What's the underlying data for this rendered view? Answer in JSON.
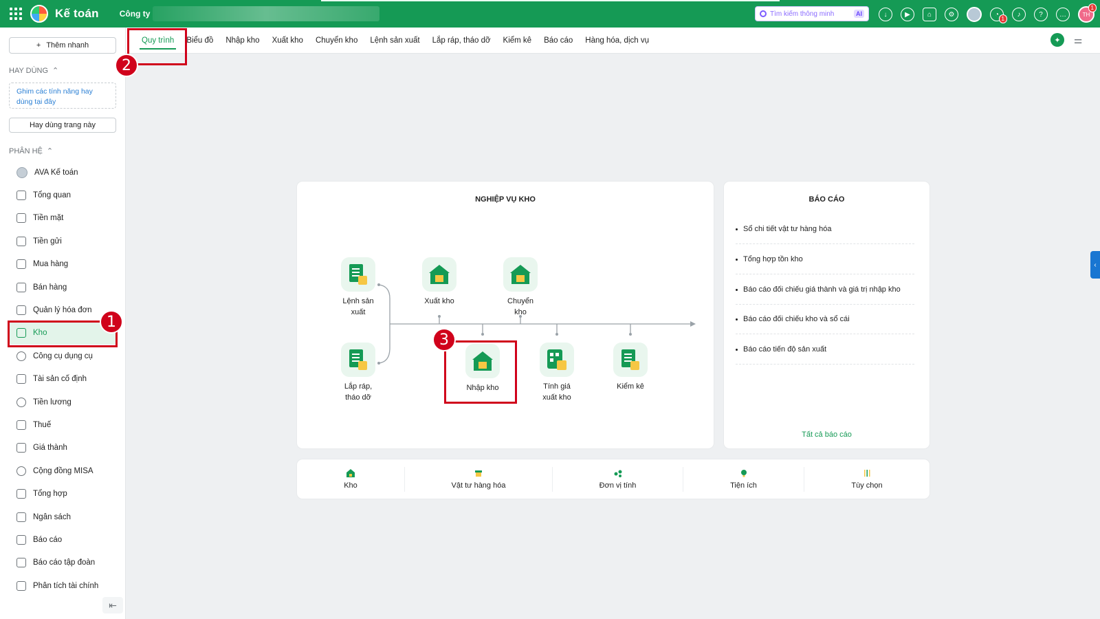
{
  "app": {
    "title": "Kế toán",
    "company_label": "Công ty"
  },
  "search": {
    "placeholder": "Tìm kiếm thông minh",
    "ai_badge": "AI"
  },
  "top_badges": {
    "chat_count": "1",
    "avatar_initials": "TH",
    "avatar_badge": "1"
  },
  "sidebar": {
    "add_button": "Thêm nhanh",
    "favorites_header": "HAY DÙNG",
    "pin_hint": "Ghim các tính năng hay dùng tại đây",
    "favorite_page_button": "Hay dùng trang này",
    "modules_header": "PHÂN HỆ",
    "items": [
      {
        "label": "AVA Kế toán",
        "icon": "ava-avatar-icon"
      },
      {
        "label": "Tổng quan",
        "icon": "dashboard-icon"
      },
      {
        "label": "Tiền mặt",
        "icon": "cash-icon"
      },
      {
        "label": "Tiền gửi",
        "icon": "bank-icon"
      },
      {
        "label": "Mua hàng",
        "icon": "shopping-bag-icon"
      },
      {
        "label": "Bán hàng",
        "icon": "cart-icon"
      },
      {
        "label": "Quản lý hóa đơn",
        "icon": "invoice-icon"
      },
      {
        "label": "Kho",
        "icon": "warehouse-icon"
      },
      {
        "label": "Công cụ dụng cụ",
        "icon": "tools-icon"
      },
      {
        "label": "Tài sản cố định",
        "icon": "truck-icon"
      },
      {
        "label": "Tiền lương",
        "icon": "salary-icon"
      },
      {
        "label": "Thuế",
        "icon": "tax-icon"
      },
      {
        "label": "Giá thành",
        "icon": "price-tag-icon"
      },
      {
        "label": "Cộng đồng MISA",
        "icon": "community-icon"
      },
      {
        "label": "Tổng hợp",
        "icon": "summary-icon"
      },
      {
        "label": "Ngân sách",
        "icon": "budget-icon"
      },
      {
        "label": "Báo cáo",
        "icon": "bar-chart-icon"
      },
      {
        "label": "Báo cáo tập đoàn",
        "icon": "group-report-icon"
      },
      {
        "label": "Phân tích tài chính",
        "icon": "analytics-icon"
      }
    ],
    "active_item": "Kho"
  },
  "tabs": [
    "Quy trình",
    "Biểu đồ",
    "Nhập kho",
    "Xuất kho",
    "Chuyển kho",
    "Lệnh sản xuất",
    "Lắp ráp, tháo dỡ",
    "Kiểm kê",
    "Báo cáo",
    "Hàng hóa, dịch vụ"
  ],
  "active_tab": "Quy trình",
  "workflow": {
    "title": "NGHIỆP VỤ KHO",
    "nodes": {
      "production_order": "Lệnh sản xuất",
      "stock_out": "Xuất kho",
      "transfer": "Chuyển kho",
      "assembly": "Lắp ráp, tháo dỡ",
      "stock_in": "Nhập kho",
      "cost_calc": "Tính giá xuất kho",
      "inventory_count": "Kiểm kê"
    }
  },
  "reports": {
    "title": "BÁO CÁO",
    "items": [
      "Sổ chi tiết vật tư hàng hóa",
      "Tổng hợp tồn kho",
      "Báo cáo đối chiếu giá thành và giá trị nhập kho",
      "Báo cáo đối chiếu kho và sổ cái",
      "Báo cáo tiến độ sản xuất"
    ],
    "all_link": "Tất cả báo cáo"
  },
  "bottom_bar": [
    "Kho",
    "Vật tư hàng hóa",
    "Đơn vị tính",
    "Tiện ích",
    "Tùy chọn"
  ],
  "markers": [
    "1",
    "2",
    "3"
  ],
  "colors": {
    "brand": "#159a55",
    "highlight": "#d0021b",
    "accent_yellow": "#f6c744"
  }
}
